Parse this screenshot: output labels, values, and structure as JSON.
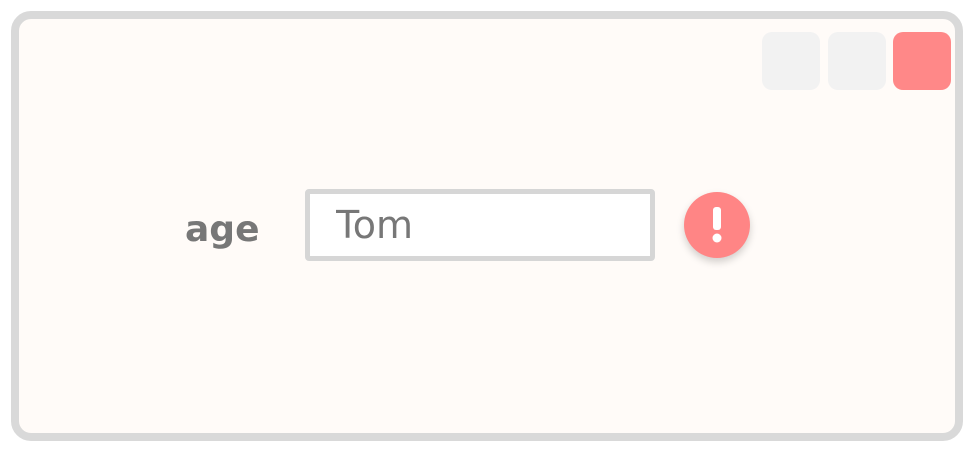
{
  "window": {
    "buttons": [
      {
        "name": "minimize",
        "icon": "minimize-icon"
      },
      {
        "name": "maximize",
        "icon": "maximize-icon"
      },
      {
        "name": "close",
        "icon": "close-icon",
        "color": "#ff8888"
      }
    ]
  },
  "form": {
    "field_label": "age",
    "field_value": "Tom",
    "error_icon": "exclamation-icon",
    "error_color": "#ff8585"
  }
}
